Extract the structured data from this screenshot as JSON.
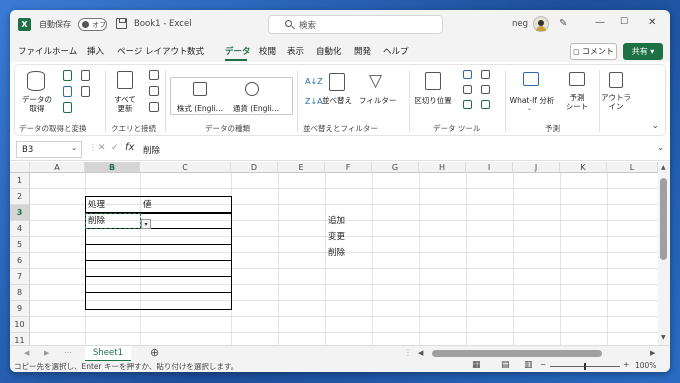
{
  "titlebar": {
    "autosave_label": "自動保存",
    "autosave_state": "オフ",
    "doc_title": "Book1 - Excel",
    "search_placeholder": "検索",
    "user_name": "neg"
  },
  "menu": {
    "tabs": [
      "ファイル",
      "ホーム",
      "挿入",
      "ページ レイアウト",
      "数式",
      "データ",
      "校閲",
      "表示",
      "自動化",
      "開発",
      "ヘルプ"
    ],
    "active_tab": "データ",
    "comment_label": "コメント",
    "share_label": "共有"
  },
  "ribbon": {
    "groups": [
      {
        "label": "データの取得と変換",
        "big_button": "データの\n取得"
      },
      {
        "label": "クエリと接続",
        "big_button": "すべて\n更新"
      },
      {
        "label": "データの種類",
        "items": [
          "株式 (Engli…",
          "通貨 (Engli…"
        ]
      },
      {
        "label": "並べ替えとフィルター",
        "buttons": [
          "並べ替え",
          "フィルター"
        ]
      },
      {
        "label": "データ ツール",
        "buttons": [
          "区切り位置"
        ]
      },
      {
        "label": "予測",
        "buttons": [
          "What-If 分析",
          "予測\nシート"
        ]
      },
      {
        "label": "",
        "buttons": [
          "アウトラ\nイン"
        ]
      }
    ]
  },
  "formula_bar": {
    "name_box": "B3",
    "content": "削除"
  },
  "sheet": {
    "columns": [
      "A",
      "B",
      "C",
      "D",
      "E",
      "F",
      "G",
      "H",
      "I",
      "J",
      "K",
      "L"
    ],
    "rows": [
      "1",
      "2",
      "3",
      "4",
      "5",
      "6",
      "7",
      "8",
      "9",
      "10",
      "11"
    ],
    "selected_cell": "B3",
    "cells": {
      "B2": "処理",
      "C2": "値",
      "B3": "削除",
      "F3": "追加",
      "F4": "変更",
      "F5": "削除"
    }
  },
  "sheet_tabs": [
    "Sheet1"
  ],
  "status": {
    "message": "コピー先を選択し、Enter キーを押すか、貼り付けを選択します。",
    "zoom": "100%"
  }
}
